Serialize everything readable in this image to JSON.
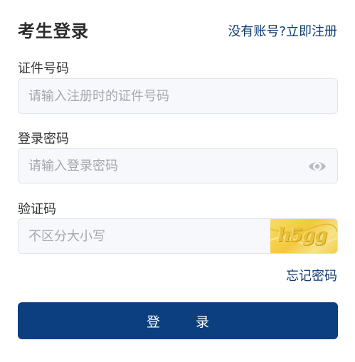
{
  "header": {
    "title": "考生登录",
    "register_link": "没有账号?立即注册"
  },
  "form": {
    "id_field": {
      "label": "证件号码",
      "placeholder": "请输入注册时的证件号码",
      "value": ""
    },
    "password_field": {
      "label": "登录密码",
      "placeholder": "请输入登录密码",
      "value": "",
      "toggle_icon": "eye-icon"
    },
    "captcha_field": {
      "label": "验证码",
      "placeholder": "不区分大小写",
      "value": "",
      "captcha_image_text": "h5gg"
    },
    "forgot_password": "忘记密码",
    "login_button": "登 录"
  },
  "colors": {
    "accent": "#0b3f7f",
    "link": "#0d3b73",
    "input_bg": "#f7f8fb",
    "input_border": "#dfe3ea",
    "captcha_bg": "#f2c93c"
  }
}
